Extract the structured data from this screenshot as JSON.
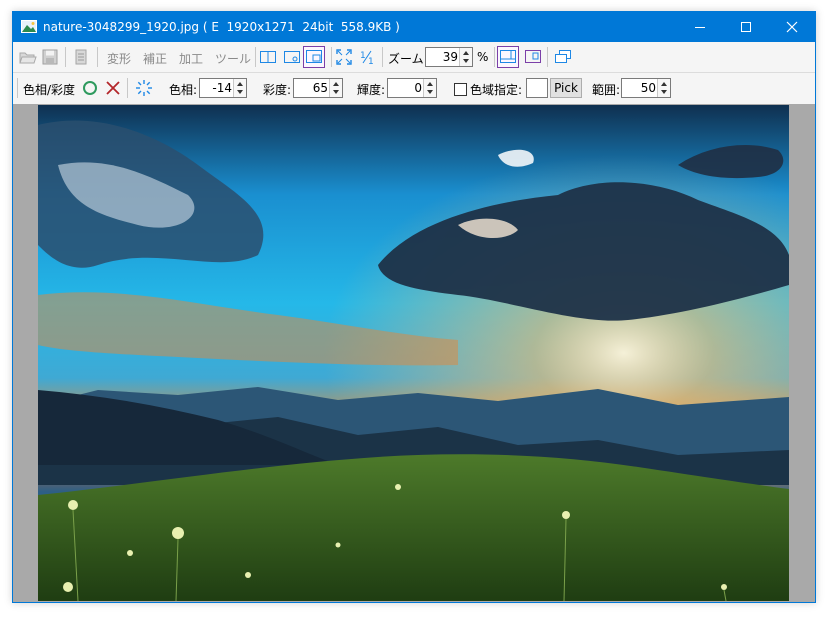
{
  "window": {
    "title": "nature-3048299_1920.jpg ( E  1920x1271  24bit  558.9KB )"
  },
  "toolbar": {
    "menu_transform": "変形",
    "menu_correct": "補正",
    "menu_process": "加工",
    "menu_tool": "ツール",
    "zoom_label": "ズーム:",
    "zoom_value": "39",
    "zoom_unit": "%"
  },
  "adjust": {
    "mode_label": "色相/彩度",
    "hue_label": "色相:",
    "hue_value": "-14",
    "saturation_label": "彩度:",
    "saturation_value": "65",
    "brightness_label": "輝度:",
    "brightness_value": "0",
    "color_range_label": "色域指定:",
    "color_range_checked": false,
    "pick_label": "Pick",
    "range_label": "範囲:",
    "range_value": "50"
  },
  "colors": {
    "titlebar": "#0078d7",
    "accent_icon": "#1e88e5",
    "active_frame": "#7b3fa8",
    "apply_green": "#2e9a5e",
    "cancel_red": "#b3262a",
    "canvas_bg": "#a9a9a9"
  }
}
